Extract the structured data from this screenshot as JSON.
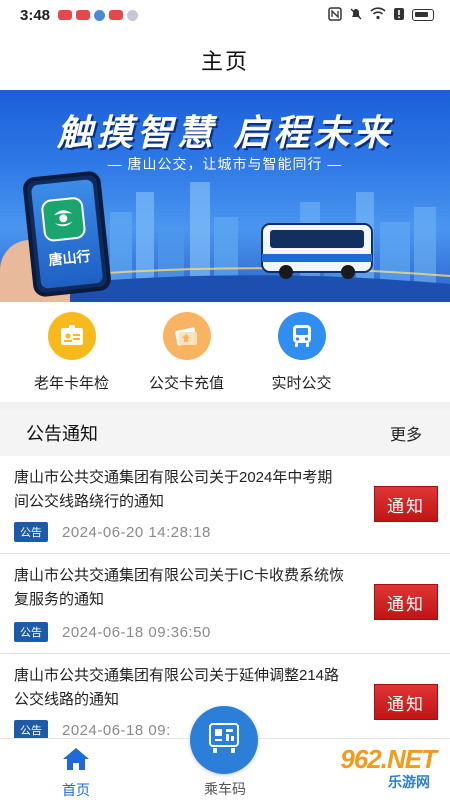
{
  "status_bar": {
    "time": "3:48"
  },
  "header": {
    "title": "主页"
  },
  "banner": {
    "slogan": "触摸智慧 启程未来",
    "subslogan": "— 唐山公交，让城市与智能同行 —",
    "app_label": "唐山行"
  },
  "quick_actions": [
    {
      "label": "老年卡年检",
      "icon": "id-card-icon"
    },
    {
      "label": "公交卡充值",
      "icon": "card-recharge-icon"
    },
    {
      "label": "实时公交",
      "icon": "bus-icon"
    }
  ],
  "announcements": {
    "title": "公告通知",
    "more": "更多",
    "items": [
      {
        "title": "唐山市公共交通集团有限公司关于2024年中考期间公交线路绕行的通知",
        "tag": "公告",
        "date": "2024-06-20 14:28:18",
        "badge": "通知"
      },
      {
        "title": "唐山市公共交通集团有限公司关于IC卡收费系统恢复服务的通知",
        "tag": "公告",
        "date": "2024-06-18 09:36:50",
        "badge": "通知"
      },
      {
        "title": "唐山市公共交通集团有限公司关于延伸调整214路公交线路的通知",
        "tag": "公告",
        "date": "2024-06-18 09:",
        "badge": "通知"
      }
    ]
  },
  "bottom_nav": {
    "home": "首页",
    "ride_code": "乘车码"
  },
  "watermark": {
    "brand": "962.NET",
    "sub": "乐游网"
  },
  "colors": {
    "primary": "#1f6ad6",
    "notice_red": "#d02020",
    "tag_blue": "#1d5ba8"
  }
}
